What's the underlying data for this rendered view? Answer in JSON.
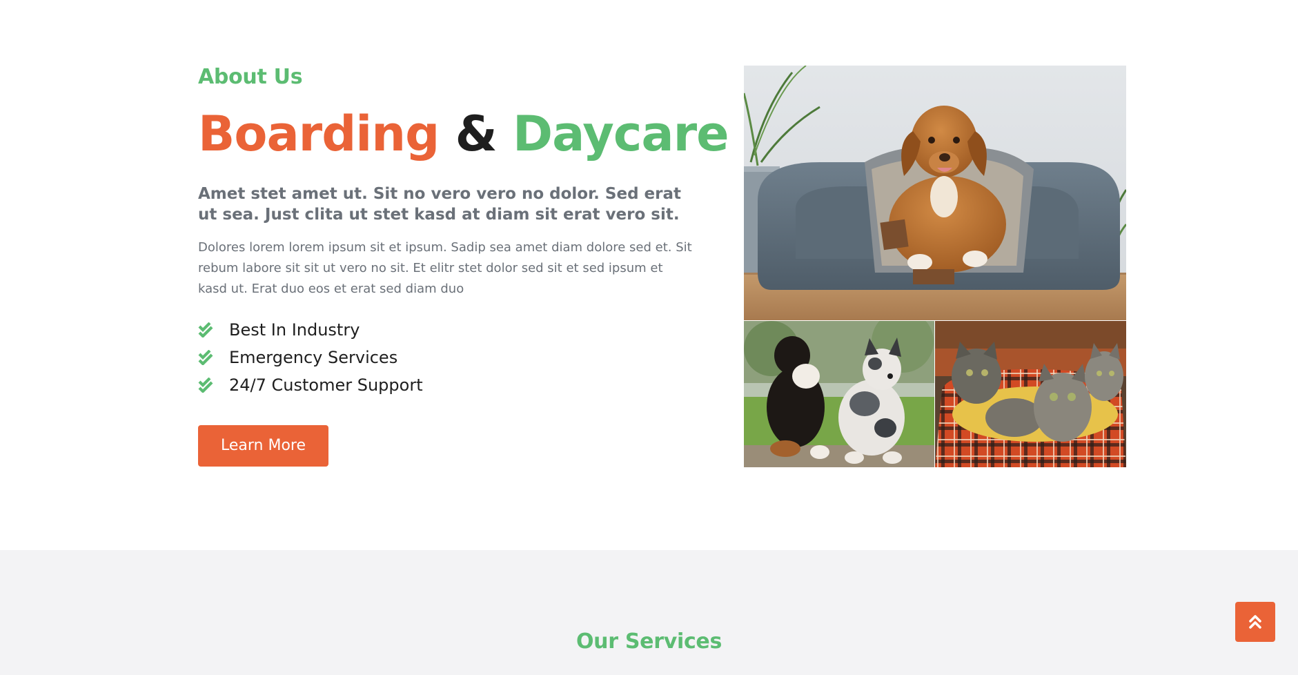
{
  "about": {
    "eyebrow": "About Us",
    "headline": {
      "word1": "Boarding",
      "connector": "&",
      "word2": "Daycare"
    },
    "lead": "Amet stet amet ut. Sit no vero vero no dolor. Sed erat ut sea. Just clita ut stet kasd at diam sit erat vero sit.",
    "body": "Dolores lorem lorem ipsum sit et ipsum. Sadip sea amet diam dolore sed et. Sit rebum labore sit sit ut vero no sit. Et elitr stet dolor sed sit et sed ipsum et kasd ut. Erat duo eos et erat sed diam duo",
    "features": [
      {
        "label": "Best In Industry",
        "icon": "check-double-icon"
      },
      {
        "label": "Emergency Services",
        "icon": "check-double-icon"
      },
      {
        "label": "24/7 Customer Support",
        "icon": "check-double-icon"
      }
    ],
    "cta_label": "Learn More"
  },
  "photos": [
    {
      "name": "dog-in-bed-photo"
    },
    {
      "name": "two-dogs-photo"
    },
    {
      "name": "kittens-in-basket-photo"
    }
  ],
  "services": {
    "eyebrow": "Our Services"
  },
  "back_to_top": {
    "icon": "angle-double-up-icon"
  },
  "colors": {
    "accent_orange": "#ea6337",
    "accent_green": "#5cbc72",
    "heading_dark": "#1e1e1e",
    "body_gray": "#6a7078",
    "section_gray": "#f3f3f5"
  }
}
